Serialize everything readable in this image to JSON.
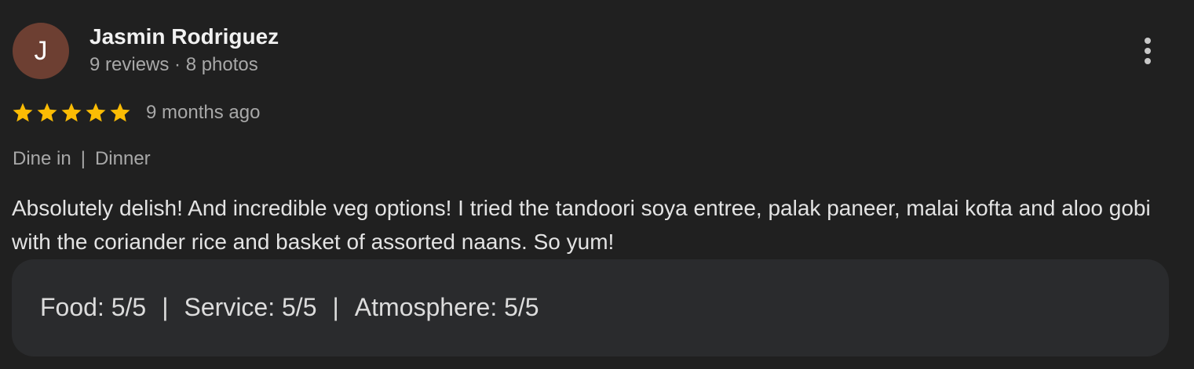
{
  "reviewer": {
    "initial": "J",
    "name": "Jasmin Rodriguez",
    "meta": "9 reviews · 8 photos",
    "avatar_color": "#6d3f32"
  },
  "rating": {
    "stars": 5,
    "max_stars": 5,
    "star_color": "#fbbc04",
    "date": "9 months ago"
  },
  "service": {
    "type": "Dine in",
    "separator": "|",
    "meal": "Dinner"
  },
  "review_text": "Absolutely delish! And incredible veg options! I tried the tandoori soya entree, palak paneer, malai kofta and aloo gobi with the coriander rice and basket of assorted naans. So yum!",
  "aspects": {
    "food": "Food: 5/5",
    "service": "Service: 5/5",
    "atmosphere": "Atmosphere: 5/5",
    "separator": "|"
  },
  "menu": {
    "icon": "more-vert-icon"
  }
}
